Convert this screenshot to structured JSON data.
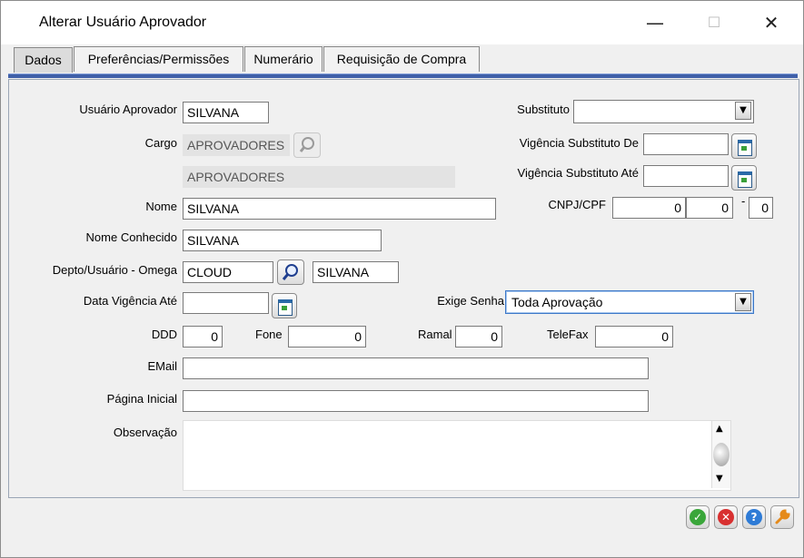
{
  "window": {
    "title": "Alterar Usuário Aprovador",
    "minimize_glyph": "—",
    "maximize_glyph": "☐",
    "close_glyph": "✕"
  },
  "tabs": [
    {
      "label": "Dados",
      "active": true
    },
    {
      "label": "Preferências/Permissões",
      "active": false
    },
    {
      "label": "Numerário",
      "active": false
    },
    {
      "label": "Requisição de Compra",
      "active": false
    }
  ],
  "form": {
    "usuario_aprovador": {
      "label": "Usuário Aprovador",
      "value": "SILVANA"
    },
    "cargo": {
      "label": "Cargo",
      "value": "APROVADORES",
      "description": "APROVADORES"
    },
    "nome": {
      "label": "Nome",
      "value": "SILVANA"
    },
    "nome_conhecido": {
      "label": "Nome Conhecido",
      "value": "SILVANA"
    },
    "depto_usuario_omega": {
      "label": "Depto/Usuário - Omega",
      "depto": "CLOUD",
      "usuario": "SILVANA"
    },
    "data_vigencia_ate": {
      "label": "Data Vigência Até",
      "value": ""
    },
    "ddd": {
      "label": "DDD",
      "value": "0"
    },
    "fone": {
      "label": "Fone",
      "value": "0"
    },
    "ramal": {
      "label": "Ramal",
      "value": "0"
    },
    "telefax": {
      "label": "TeleFax",
      "value": "0"
    },
    "email": {
      "label": "EMail",
      "value": ""
    },
    "pagina_inicial": {
      "label": "Página Inicial",
      "value": ""
    },
    "observacao": {
      "label": "Observação",
      "value": ""
    },
    "substituto": {
      "label": "Substituto",
      "value": ""
    },
    "vigencia_substituto_de": {
      "label": "Vigência Substituto De",
      "value": ""
    },
    "vigencia_substituto_ate": {
      "label": "Vigência Substituto Até",
      "value": ""
    },
    "cnpj_cpf": {
      "label": "CNPJ/CPF",
      "part1": "0",
      "part2": "0",
      "separator": "-",
      "part3": "0"
    },
    "exige_senha": {
      "label": "Exige Senha",
      "value": "Toda Aprovação"
    }
  },
  "footer": {
    "ok_icon": "✓",
    "cancel_icon": "✕",
    "help_icon": "?",
    "tools_icon": "wrench"
  },
  "colors": {
    "tab_underline": "#3f5fa8",
    "ok_green": "#3aa63a",
    "cancel_red": "#d83030",
    "help_blue": "#2e7bd6",
    "tools_orange": "#e58a1a"
  }
}
